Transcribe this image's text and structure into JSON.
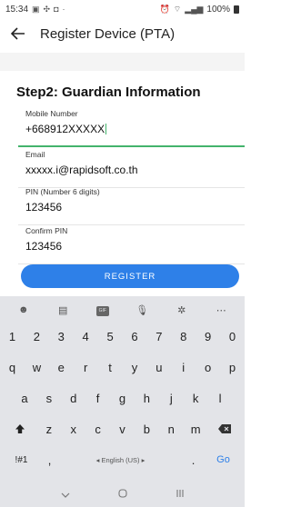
{
  "status_bar": {
    "time": "15:34",
    "battery": "100%"
  },
  "app_bar": {
    "title": "Register Device (PTA)"
  },
  "form": {
    "step_title": "Step2: Guardian Information",
    "fields": [
      {
        "label": "Mobile Number",
        "value": "+668912XXXXX"
      },
      {
        "label": "Email",
        "value": "xxxxx.i@rapidsoft.co.th"
      },
      {
        "label": "PIN (Number 6 digits)",
        "value": "123456"
      },
      {
        "label": "Confirm PIN",
        "value": "123456"
      }
    ],
    "register_label": "REGISTER"
  },
  "keyboard": {
    "toolbar": [
      "emoji-icon",
      "sticker-icon",
      "gif-icon",
      "microphone-icon",
      "settings-icon",
      "more-icon"
    ],
    "gif_label": "GIF",
    "numbers": [
      "1",
      "2",
      "3",
      "4",
      "5",
      "6",
      "7",
      "8",
      "9",
      "0"
    ],
    "row1": [
      "q",
      "w",
      "e",
      "r",
      "t",
      "y",
      "u",
      "i",
      "o",
      "p"
    ],
    "row2": [
      "a",
      "s",
      "d",
      "f",
      "g",
      "h",
      "j",
      "k",
      "l"
    ],
    "row3": [
      "z",
      "x",
      "c",
      "v",
      "b",
      "n",
      "m"
    ],
    "symbols_label": "!#1",
    "comma": ",",
    "space_label": "◂ English (US) ▸",
    "period": ".",
    "go_label": "Go"
  },
  "colors": {
    "accent": "#2e80e8",
    "focus": "#43b36c"
  }
}
